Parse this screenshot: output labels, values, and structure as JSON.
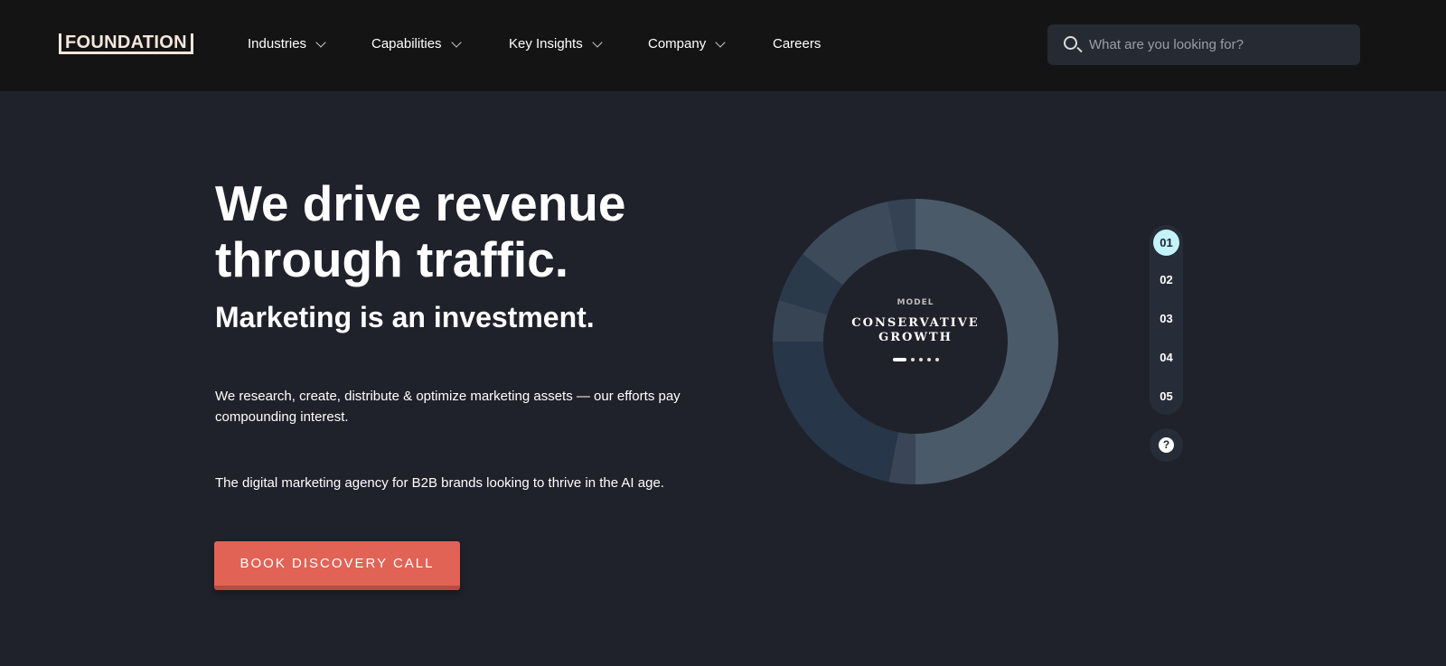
{
  "nav": {
    "logo": "FOUNDATION",
    "items": [
      {
        "label": "Industries",
        "dropdown": true
      },
      {
        "label": "Capabilities",
        "dropdown": true
      },
      {
        "label": "Key Insights",
        "dropdown": true
      },
      {
        "label": "Company",
        "dropdown": true
      },
      {
        "label": "Careers",
        "dropdown": false
      }
    ],
    "search_placeholder": "What are you looking for?"
  },
  "hero": {
    "title": "We drive revenue through traffic.",
    "subtitle": "Marketing is an investment.",
    "para1": "We research, create, distribute & optimize marketing assets — our efforts pay compounding interest.",
    "para2": "The digital marketing agency for B2B brands looking to thrive in the AI age.",
    "cta": "BOOK DISCOVERY CALL"
  },
  "model": {
    "label": "MODEL",
    "name_line1": "CONSERVATIVE",
    "name_line2": "GROWTH",
    "active_dot": 0,
    "dot_count": 5,
    "segments": [
      {
        "share": 50,
        "color": "#4a5a68"
      },
      {
        "share": 3,
        "color": "#3a4658"
      },
      {
        "share": 22,
        "color": "#273648"
      },
      {
        "share": 4.7,
        "color": "#364454"
      },
      {
        "share": 5.8,
        "color": "#2b3a4b"
      },
      {
        "share": 11.4,
        "color": "#3c4a5a"
      },
      {
        "share": 3.1,
        "color": "#344254"
      }
    ]
  },
  "steps": {
    "items": [
      "01",
      "02",
      "03",
      "04",
      "05"
    ],
    "active": 0,
    "help": "?"
  }
}
